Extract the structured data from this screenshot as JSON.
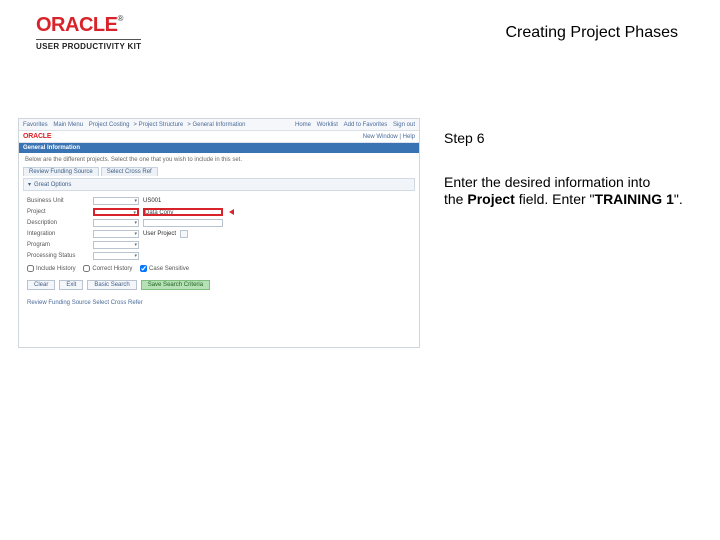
{
  "branding": {
    "logo_text": "ORACLE",
    "trademark": "®",
    "subline": "USER PRODUCTIVITY KIT"
  },
  "page_title": "Creating Project Phases",
  "instruction": {
    "step_label": "Step 6",
    "line1": "Enter the desired information into",
    "line2_pre": "the ",
    "line2_bold1": "Project",
    "line2_mid": " field. Enter \"",
    "line2_bold2": "TRAINING 1",
    "line2_post": "\"."
  },
  "app": {
    "breadcrumbs": [
      "Favorites",
      "Main Menu",
      "Project Costing",
      "Project Structure",
      "General Information"
    ],
    "toolbar": [
      "Home",
      "Worklist",
      "Add to Favorites",
      "Sign out"
    ],
    "mini_brand": "ORACLE",
    "new_window_label": "New Window | Help",
    "section_title": "General Information",
    "note_text": "Below are the different projects. Select the one that you wish to include in this set.",
    "subtabs": [
      "Review Funding Source",
      "Select Cross Ref"
    ],
    "group_header": "Great Options",
    "fields": {
      "business_unit": {
        "label": "Business Unit",
        "value": "US001"
      },
      "project": {
        "label": "Project",
        "value": "Data Conv"
      },
      "description": {
        "label": "Description",
        "value": ""
      },
      "integration": {
        "label": "Integration",
        "value": "User Project"
      },
      "program": {
        "label": "Program",
        "value": ""
      },
      "processing_status": {
        "label": "Processing Status",
        "value": ""
      }
    },
    "check_labels": [
      "Include History",
      "Correct History",
      "Case Sensitive"
    ],
    "buttons": {
      "clear": "Clear",
      "exit": "Exit",
      "basic_search": "Basic Search",
      "save": "Save Search Criteria"
    },
    "footer_link": "Review Funding Source  Select Cross Refer"
  }
}
